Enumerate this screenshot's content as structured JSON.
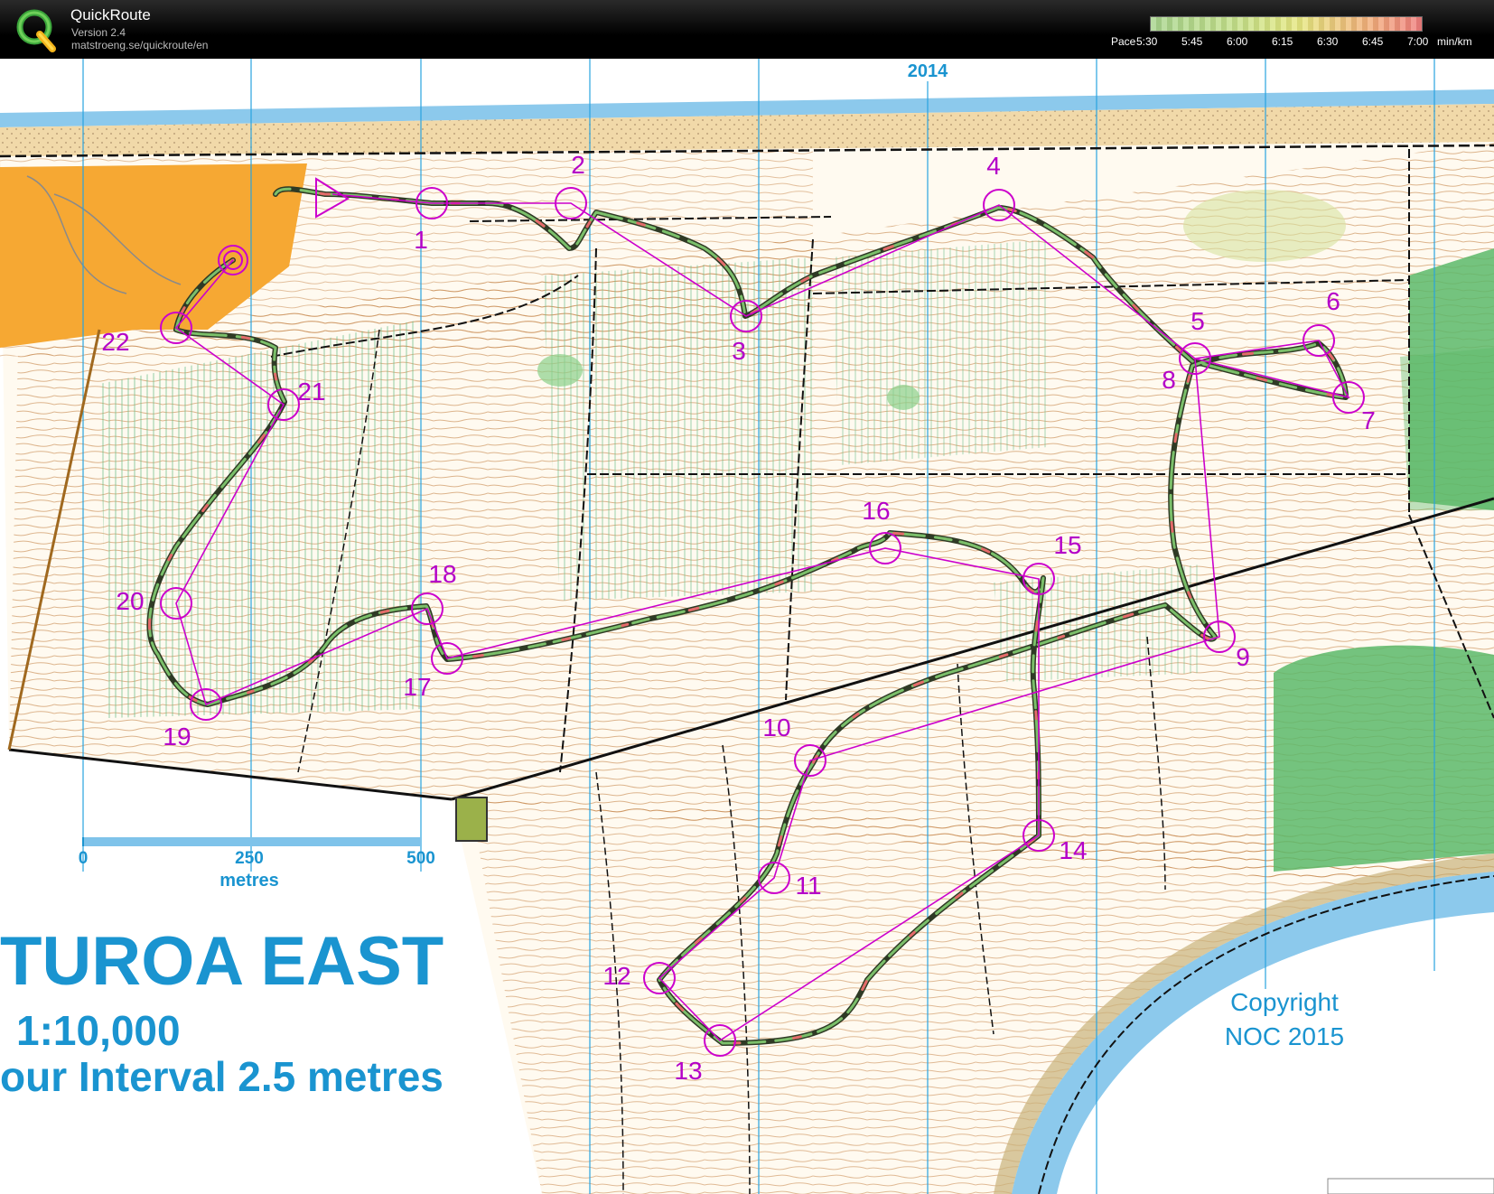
{
  "app": {
    "name": "QuickRoute",
    "version": "Version 2.4",
    "url": "matstroeng.se/quickroute/en"
  },
  "pace_legend": {
    "label": "Pace",
    "ticks": [
      "5:30",
      "5:45",
      "6:00",
      "6:15",
      "6:30",
      "6:45",
      "7:00"
    ],
    "unit": "min/km",
    "colors": [
      "#a7d48d",
      "#e6e77f",
      "#ef7c7c"
    ]
  },
  "map": {
    "title": "TUROA EAST",
    "scale": "1:10,000",
    "contour": "our Interval 2.5 metres",
    "grid_label": "2014",
    "scale_bar": {
      "ticks": [
        "0",
        "250",
        "500"
      ],
      "unit": "metres"
    },
    "copyright_line1": "Copyright",
    "copyright_line2": "NOC 2015",
    "controls": [
      "1",
      "2",
      "3",
      "4",
      "5",
      "6",
      "7",
      "8",
      "9",
      "10",
      "11",
      "12",
      "13",
      "14",
      "15",
      "16",
      "17",
      "18",
      "19",
      "20",
      "21",
      "22"
    ],
    "colors": {
      "course": "#cc00cc",
      "grid_line": "#29a3e0",
      "label_blue": "#1a94d0",
      "sea": "#7fc3ea",
      "open_land": "#f6a833",
      "forest_green": "#5cb86a",
      "contour": "#c07a3a",
      "track": "#000000"
    }
  }
}
